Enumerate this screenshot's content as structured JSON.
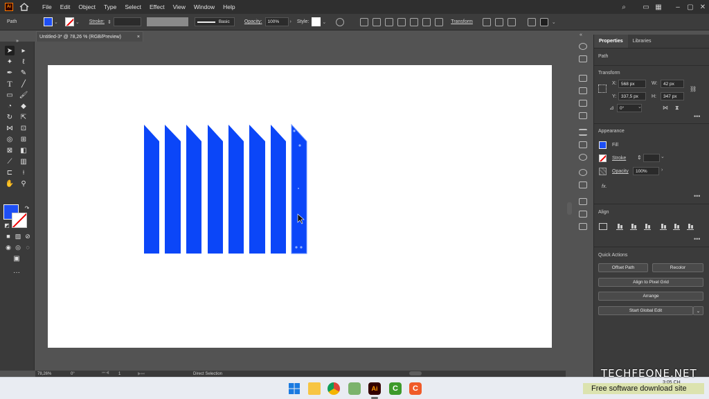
{
  "app": {
    "logo": "Ai"
  },
  "menu": {
    "items": [
      "File",
      "Edit",
      "Object",
      "Type",
      "Select",
      "Effect",
      "View",
      "Window",
      "Help"
    ]
  },
  "control_bar": {
    "selection_type": "Path",
    "stroke_label": "Stroke:",
    "brush_style": "Basic",
    "opacity_label": "Opacity:",
    "opacity_value": "100%",
    "style_label": "Style:",
    "transform_label": "Transform",
    "colors": {
      "fill": "#1e4ff5"
    }
  },
  "document_tab": {
    "title": "Untitled-3* @ 78,26 % (RGB/Preview)",
    "close": "×"
  },
  "status_bar": {
    "zoom": "78,26%",
    "rotation": "0°",
    "artboard": "1",
    "tool": "Direct Selection"
  },
  "panel": {
    "tabs": [
      "Properties",
      "Libraries"
    ],
    "selection": "Path",
    "transform": {
      "header": "Transform",
      "x_label": "X:",
      "x": "568 px",
      "y_label": "Y:",
      "y": "337,5 px",
      "w_label": "W:",
      "w": "42 px",
      "h_label": "H:",
      "h": "347 px",
      "angle": "0°"
    },
    "appearance": {
      "header": "Appearance",
      "fill": "Fill",
      "stroke": "Stroke",
      "opacity_label": "Opacity",
      "opacity": "100%",
      "fx": "fx."
    },
    "align": {
      "header": "Align"
    },
    "quick_actions": {
      "header": "Quick Actions",
      "offset_path": "Offset Path",
      "recolor": "Recolor",
      "align_to_pixel_grid": "Align to Pixel Grid",
      "arrange": "Arrange",
      "start_global_edit": "Start Global Edit"
    }
  },
  "taskbar": {
    "time": "3:05 CH"
  },
  "watermark": {
    "title": "TECHFEONE.NET",
    "subtitle": "Free software download site"
  }
}
